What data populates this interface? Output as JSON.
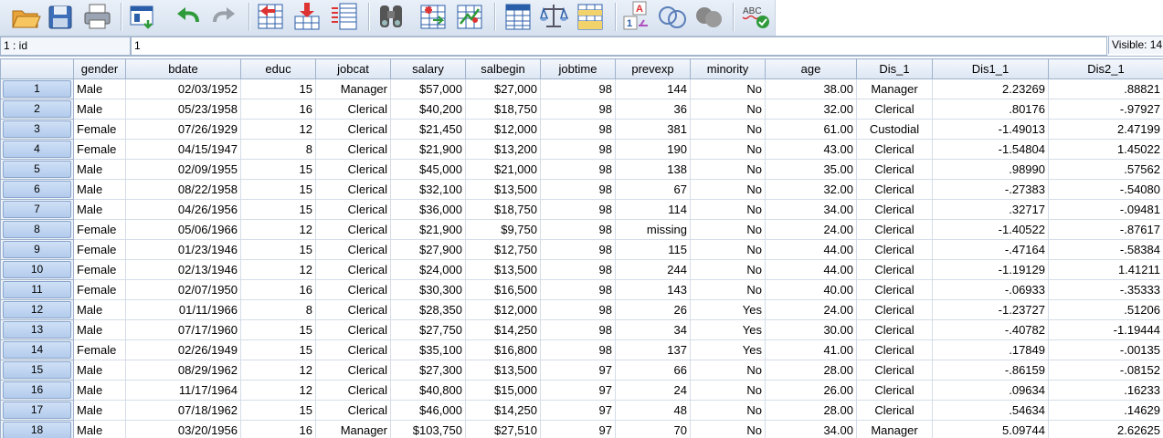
{
  "toolbar": {
    "icons": [
      "open-folder-icon",
      "save-icon",
      "print-icon",
      "dialog-recall-icon",
      "undo-icon",
      "redo-icon",
      "goto-case-icon",
      "goto-variable-icon",
      "variables-icon",
      "find-icon",
      "insert-cases-icon",
      "insert-variable-icon",
      "split-file-icon",
      "weight-cases-icon",
      "select-cases-icon",
      "value-labels-icon",
      "use-variable-sets-icon",
      "show-all-variables-icon",
      "spell-check-icon"
    ],
    "spell_check_label": "ABC"
  },
  "editbar": {
    "cell_ref": "1 : id",
    "cell_value": "1",
    "visible_label": "Visible: 14"
  },
  "columns": [
    "gender",
    "bdate",
    "educ",
    "jobcat",
    "salary",
    "salbegin",
    "jobtime",
    "prevexp",
    "minority",
    "age",
    "Dis_1",
    "Dis1_1",
    "Dis2_1"
  ],
  "rows": [
    {
      "n": "1",
      "gender": "Male",
      "bdate": "02/03/1952",
      "educ": "15",
      "jobcat": "Manager",
      "salary": "$57,000",
      "salbegin": "$27,000",
      "jobtime": "98",
      "prevexp": "144",
      "minority": "No",
      "age": "38.00",
      "dis1": "Manager",
      "dis1_1": "2.23269",
      "dis2_1": ".88821"
    },
    {
      "n": "2",
      "gender": "Male",
      "bdate": "05/23/1958",
      "educ": "16",
      "jobcat": "Clerical",
      "salary": "$40,200",
      "salbegin": "$18,750",
      "jobtime": "98",
      "prevexp": "36",
      "minority": "No",
      "age": "32.00",
      "dis1": "Clerical",
      "dis1_1": ".80176",
      "dis2_1": "-.97927"
    },
    {
      "n": "3",
      "gender": "Female",
      "bdate": "07/26/1929",
      "educ": "12",
      "jobcat": "Clerical",
      "salary": "$21,450",
      "salbegin": "$12,000",
      "jobtime": "98",
      "prevexp": "381",
      "minority": "No",
      "age": "61.00",
      "dis1": "Custodial",
      "dis1_1": "-1.49013",
      "dis2_1": "2.47199"
    },
    {
      "n": "4",
      "gender": "Female",
      "bdate": "04/15/1947",
      "educ": "8",
      "jobcat": "Clerical",
      "salary": "$21,900",
      "salbegin": "$13,200",
      "jobtime": "98",
      "prevexp": "190",
      "minority": "No",
      "age": "43.00",
      "dis1": "Clerical",
      "dis1_1": "-1.54804",
      "dis2_1": "1.45022"
    },
    {
      "n": "5",
      "gender": "Male",
      "bdate": "02/09/1955",
      "educ": "15",
      "jobcat": "Clerical",
      "salary": "$45,000",
      "salbegin": "$21,000",
      "jobtime": "98",
      "prevexp": "138",
      "minority": "No",
      "age": "35.00",
      "dis1": "Clerical",
      "dis1_1": ".98990",
      "dis2_1": ".57562"
    },
    {
      "n": "6",
      "gender": "Male",
      "bdate": "08/22/1958",
      "educ": "15",
      "jobcat": "Clerical",
      "salary": "$32,100",
      "salbegin": "$13,500",
      "jobtime": "98",
      "prevexp": "67",
      "minority": "No",
      "age": "32.00",
      "dis1": "Clerical",
      "dis1_1": "-.27383",
      "dis2_1": "-.54080"
    },
    {
      "n": "7",
      "gender": "Male",
      "bdate": "04/26/1956",
      "educ": "15",
      "jobcat": "Clerical",
      "salary": "$36,000",
      "salbegin": "$18,750",
      "jobtime": "98",
      "prevexp": "114",
      "minority": "No",
      "age": "34.00",
      "dis1": "Clerical",
      "dis1_1": ".32717",
      "dis2_1": "-.09481"
    },
    {
      "n": "8",
      "gender": "Female",
      "bdate": "05/06/1966",
      "educ": "12",
      "jobcat": "Clerical",
      "salary": "$21,900",
      "salbegin": "$9,750",
      "jobtime": "98",
      "prevexp": "missing",
      "minority": "No",
      "age": "24.00",
      "dis1": "Clerical",
      "dis1_1": "-1.40522",
      "dis2_1": "-.87617"
    },
    {
      "n": "9",
      "gender": "Female",
      "bdate": "01/23/1946",
      "educ": "15",
      "jobcat": "Clerical",
      "salary": "$27,900",
      "salbegin": "$12,750",
      "jobtime": "98",
      "prevexp": "115",
      "minority": "No",
      "age": "44.00",
      "dis1": "Clerical",
      "dis1_1": "-.47164",
      "dis2_1": "-.58384"
    },
    {
      "n": "10",
      "gender": "Female",
      "bdate": "02/13/1946",
      "educ": "12",
      "jobcat": "Clerical",
      "salary": "$24,000",
      "salbegin": "$13,500",
      "jobtime": "98",
      "prevexp": "244",
      "minority": "No",
      "age": "44.00",
      "dis1": "Clerical",
      "dis1_1": "-1.19129",
      "dis2_1": "1.41211"
    },
    {
      "n": "11",
      "gender": "Female",
      "bdate": "02/07/1950",
      "educ": "16",
      "jobcat": "Clerical",
      "salary": "$30,300",
      "salbegin": "$16,500",
      "jobtime": "98",
      "prevexp": "143",
      "minority": "No",
      "age": "40.00",
      "dis1": "Clerical",
      "dis1_1": "-.06933",
      "dis2_1": "-.35333"
    },
    {
      "n": "12",
      "gender": "Male",
      "bdate": "01/11/1966",
      "educ": "8",
      "jobcat": "Clerical",
      "salary": "$28,350",
      "salbegin": "$12,000",
      "jobtime": "98",
      "prevexp": "26",
      "minority": "Yes",
      "age": "24.00",
      "dis1": "Clerical",
      "dis1_1": "-1.23727",
      "dis2_1": ".51206"
    },
    {
      "n": "13",
      "gender": "Male",
      "bdate": "07/17/1960",
      "educ": "15",
      "jobcat": "Clerical",
      "salary": "$27,750",
      "salbegin": "$14,250",
      "jobtime": "98",
      "prevexp": "34",
      "minority": "Yes",
      "age": "30.00",
      "dis1": "Clerical",
      "dis1_1": "-.40782",
      "dis2_1": "-1.19444"
    },
    {
      "n": "14",
      "gender": "Female",
      "bdate": "02/26/1949",
      "educ": "15",
      "jobcat": "Clerical",
      "salary": "$35,100",
      "salbegin": "$16,800",
      "jobtime": "98",
      "prevexp": "137",
      "minority": "Yes",
      "age": "41.00",
      "dis1": "Clerical",
      "dis1_1": ".17849",
      "dis2_1": "-.00135"
    },
    {
      "n": "15",
      "gender": "Male",
      "bdate": "08/29/1962",
      "educ": "12",
      "jobcat": "Clerical",
      "salary": "$27,300",
      "salbegin": "$13,500",
      "jobtime": "97",
      "prevexp": "66",
      "minority": "No",
      "age": "28.00",
      "dis1": "Clerical",
      "dis1_1": "-.86159",
      "dis2_1": "-.08152"
    },
    {
      "n": "16",
      "gender": "Male",
      "bdate": "11/17/1964",
      "educ": "12",
      "jobcat": "Clerical",
      "salary": "$40,800",
      "salbegin": "$15,000",
      "jobtime": "97",
      "prevexp": "24",
      "minority": "No",
      "age": "26.00",
      "dis1": "Clerical",
      "dis1_1": ".09634",
      "dis2_1": ".16233"
    },
    {
      "n": "17",
      "gender": "Male",
      "bdate": "07/18/1962",
      "educ": "15",
      "jobcat": "Clerical",
      "salary": "$46,000",
      "salbegin": "$14,250",
      "jobtime": "97",
      "prevexp": "48",
      "minority": "No",
      "age": "28.00",
      "dis1": "Clerical",
      "dis1_1": ".54634",
      "dis2_1": ".14629"
    },
    {
      "n": "18",
      "gender": "Male",
      "bdate": "03/20/1956",
      "educ": "16",
      "jobcat": "Manager",
      "salary": "$103,750",
      "salbegin": "$27,510",
      "jobtime": "97",
      "prevexp": "70",
      "minority": "No",
      "age": "34.00",
      "dis1": "Manager",
      "dis1_1": "5.09744",
      "dis2_1": "2.62625"
    }
  ],
  "colors": {
    "toolbar_top": "#eaf0f8",
    "toolbar_bottom": "#d6e1ef",
    "grid_line": "#d4dde8",
    "header_border": "#9fb3cc",
    "row_button": "#b3cbec"
  }
}
